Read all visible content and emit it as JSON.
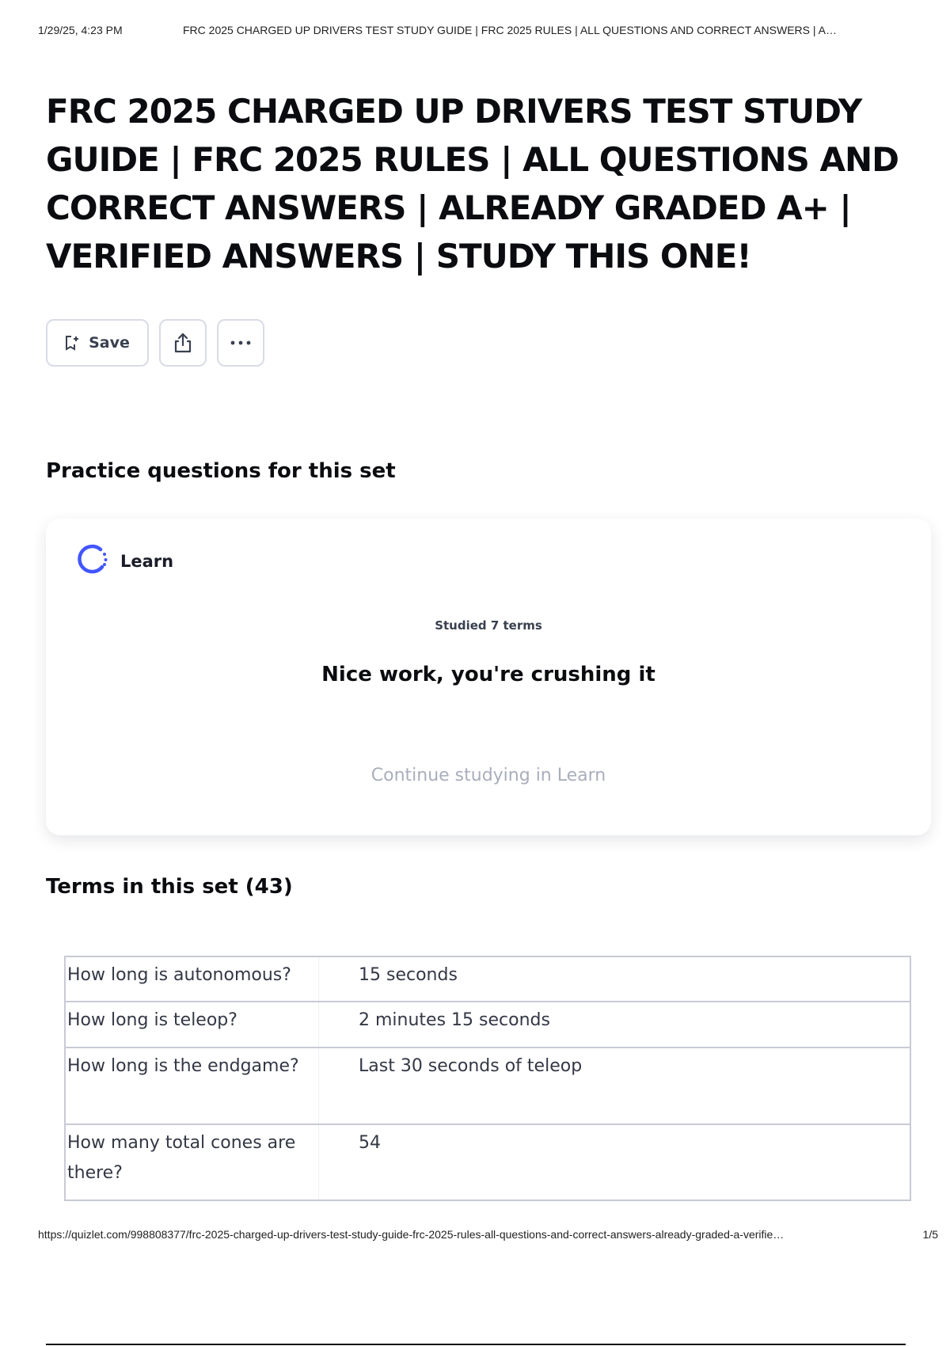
{
  "print_header": {
    "date": "1/29/25, 4:23 PM",
    "title": "FRC 2025 CHARGED UP DRIVERS TEST STUDY GUIDE | FRC 2025 RULES | ALL QUESTIONS AND CORRECT ANSWERS | A…"
  },
  "set": {
    "title": "FRC 2025 CHARGED UP DRIVERS TEST STUDY GUIDE | FRC 2025 RULES | ALL QUESTIONS AND CORRECT ANSWERS | ALREADY GRADED A+ | VERIFIED ANSWERS | STUDY THIS ONE!"
  },
  "actions": {
    "save_label": "Save",
    "icons": [
      "save-bookmark-icon",
      "share-icon",
      "more-icon"
    ]
  },
  "practice": {
    "heading": "Practice questions for this set",
    "learn_label": "Learn",
    "studied_text": "Studied 7 terms",
    "encouragement": "Nice work, you're crushing it",
    "continue_label": "Continue studying in Learn",
    "accent_color": "#4255ff"
  },
  "terms": {
    "heading": "Terms in this set (43)",
    "rows": [
      {
        "term": "How long is autonomous?",
        "definition": "15 seconds"
      },
      {
        "term": "How long is teleop?",
        "definition": "2 minutes 15 seconds"
      },
      {
        "term": "How long is the endgame?",
        "definition": "Last 30 seconds of teleop"
      },
      {
        "term": "How many total cones are there?",
        "definition": "54"
      }
    ]
  },
  "print_footer": {
    "url": "https://quizlet.com/998808377/frc-2025-charged-up-drivers-test-study-guide-frc-2025-rules-all-questions-and-correct-answers-already-graded-a-verifie…",
    "page": "1/5"
  }
}
